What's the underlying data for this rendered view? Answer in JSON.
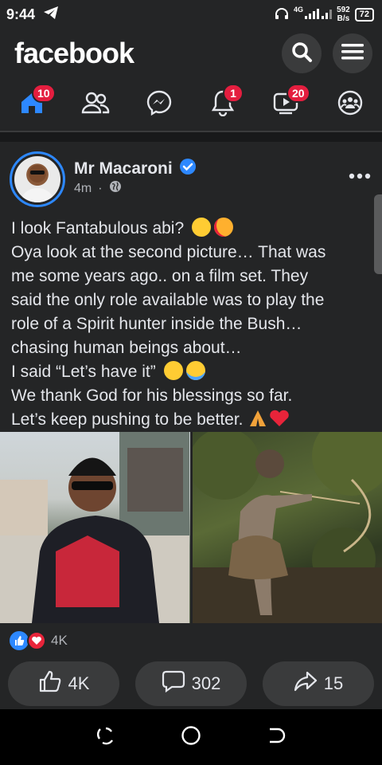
{
  "status_bar": {
    "time": "9:44",
    "network": "4G",
    "speed_value": "592",
    "speed_unit": "B/s",
    "battery": "72"
  },
  "header": {
    "logo": "facebook"
  },
  "nav": {
    "home_badge": "10",
    "notifications_badge": "1",
    "watch_badge": "20"
  },
  "post": {
    "author": "Mr Macaroni",
    "time": "4m",
    "text_lines": [
      "I look Fantabulous abi?",
      "Oya look at the second picture… That was",
      "me some years ago.. on a film set. They",
      "said the only role available was to play the",
      "role of a Spirit hunter inside the Bush…",
      "chasing human beings about…",
      "I said “Let’s have it”",
      "We thank God for his blessings so far.",
      "Let’s keep pushing to be better."
    ],
    "reactions_count": "4K",
    "actions": {
      "like_count": "4K",
      "comment_count": "302",
      "share_count": "15"
    }
  },
  "colors": {
    "background": "#242526",
    "accent": "#2d88ff",
    "badge": "#e41e3f",
    "button_bg": "#3a3b3c"
  }
}
